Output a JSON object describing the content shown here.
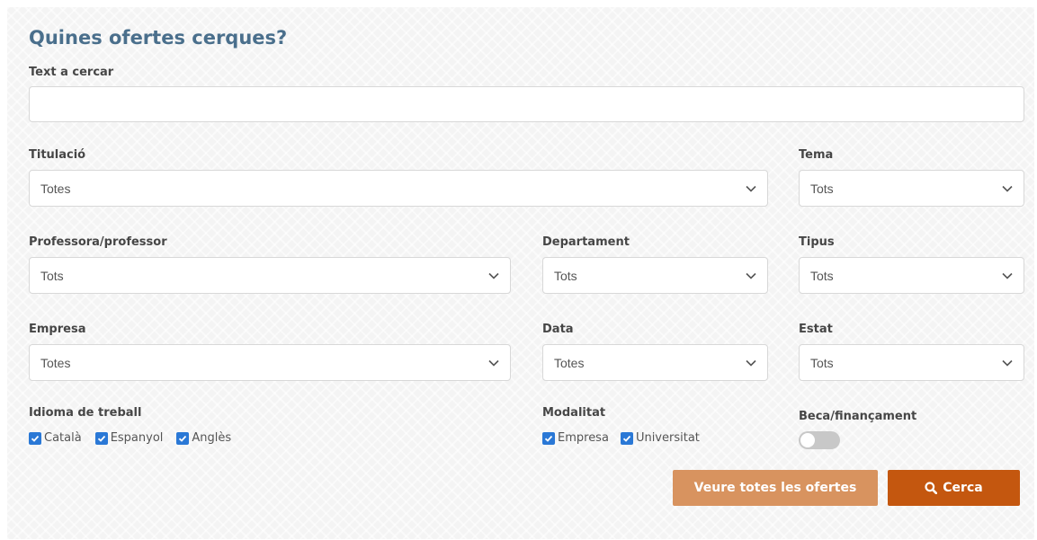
{
  "form": {
    "title": "Quines ofertes cerques?",
    "search_text": {
      "label": "Text a cercar",
      "value": ""
    },
    "titulacio": {
      "label": "Titulació",
      "value": "Totes"
    },
    "tema": {
      "label": "Tema",
      "value": "Tots"
    },
    "professor": {
      "label": "Professora/professor",
      "value": "Tots"
    },
    "departament": {
      "label": "Departament",
      "value": "Tots"
    },
    "tipus": {
      "label": "Tipus",
      "value": "Tots"
    },
    "empresa": {
      "label": "Empresa",
      "value": "Totes"
    },
    "data": {
      "label": "Data",
      "value": "Totes"
    },
    "estat": {
      "label": "Estat",
      "value": "Tots"
    },
    "idioma": {
      "label": "Idioma de treball",
      "options": [
        {
          "label": "Català",
          "checked": true
        },
        {
          "label": "Espanyol",
          "checked": true
        },
        {
          "label": "Anglès",
          "checked": true
        }
      ]
    },
    "modalitat": {
      "label": "Modalitat",
      "options": [
        {
          "label": "Empresa",
          "checked": true
        },
        {
          "label": "Universitat",
          "checked": true
        }
      ]
    },
    "beca": {
      "label": "Beca/finançament",
      "enabled": false
    }
  },
  "buttons": {
    "all_offers": "Veure totes les ofertes",
    "search": "Cerca"
  },
  "icons": {
    "select_arrow": "chevron-down-icon",
    "checkbox": "check-icon",
    "search": "search-icon"
  },
  "colors": {
    "title": "#4a6f8c",
    "checkbox": "#2a78d6",
    "all_offers_button": "#d8935f",
    "search_button": "#c4570f"
  }
}
